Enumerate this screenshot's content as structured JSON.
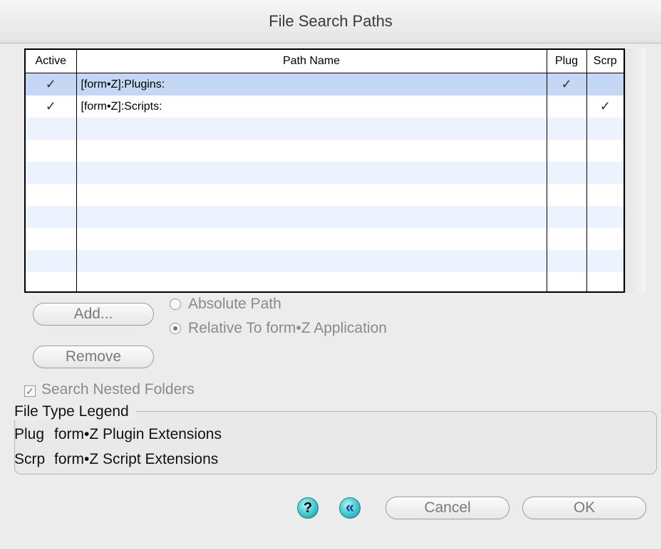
{
  "window": {
    "title": "File Search Paths"
  },
  "table": {
    "headers": {
      "active": "Active",
      "path": "Path Name",
      "plug": "Plug",
      "scrp": "Scrp"
    },
    "rows": [
      {
        "active": "✓",
        "path": "[form•Z]:Plugins:",
        "plug": "✓",
        "scrp": ""
      },
      {
        "active": "✓",
        "path": "[form•Z]:Scripts:",
        "plug": "",
        "scrp": "✓"
      }
    ]
  },
  "buttons": {
    "add": "Add...",
    "remove": "Remove",
    "cancel": "Cancel",
    "ok": "OK",
    "help_glyph": "?",
    "back_glyph": "«"
  },
  "path_mode": {
    "absolute": "Absolute Path",
    "relative": "Relative To form•Z Application",
    "selected": "relative"
  },
  "search_nested": {
    "label": "Search Nested Folders",
    "checked": true
  },
  "legend": {
    "title": "File Type Legend",
    "items": [
      {
        "code": "Plug",
        "desc": "form•Z Plugin Extensions"
      },
      {
        "code": "Scrp",
        "desc": "form•Z Script Extensions"
      }
    ]
  },
  "colors": {
    "selected_row": "#c4d8f6",
    "stripe_row": "#edf3fe",
    "icon_accent": "#3cc7cc"
  }
}
